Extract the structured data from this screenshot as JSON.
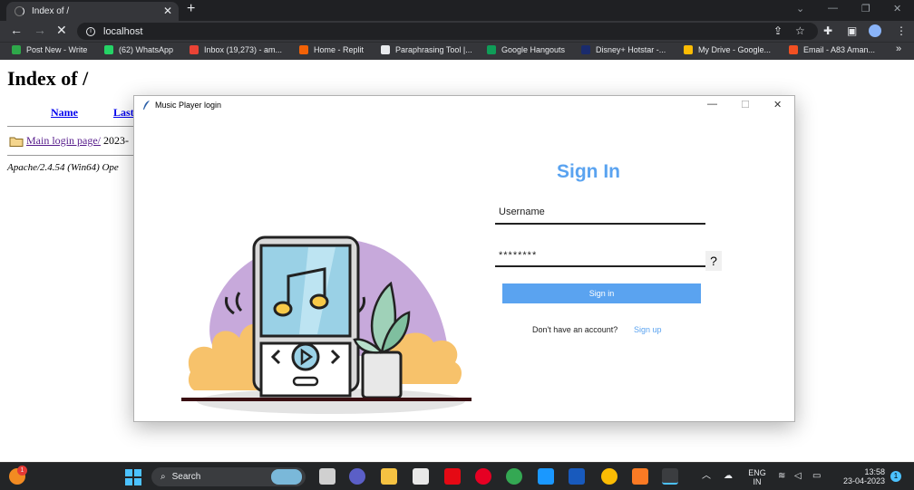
{
  "browser": {
    "tab_title": "Index of /",
    "url": "localhost",
    "bookmarks": [
      {
        "label": "Post New - Write",
        "color": "#2ea84a"
      },
      {
        "label": "(62) WhatsApp",
        "color": "#25d366"
      },
      {
        "label": "Inbox (19,273) - am...",
        "color": "#ea4335"
      },
      {
        "label": "Home - Replit",
        "color": "#f26207"
      },
      {
        "label": "Paraphrasing Tool |...",
        "color": "#e8eaed"
      },
      {
        "label": "Google Hangouts",
        "color": "#0f9d58"
      },
      {
        "label": "Disney+ Hotstar -...",
        "color": "#1a2b6d"
      },
      {
        "label": "My Drive - Google...",
        "color": "#fbbc04"
      },
      {
        "label": "Email - A83 Aman...",
        "color": "#f25022"
      }
    ],
    "more_bookmarks": "»"
  },
  "page": {
    "title": "Index of /",
    "col_name": "Name",
    "col_last": "Last",
    "row_link": "Main login page/",
    "row_date": "2023-",
    "server": "Apache/2.4.54 (Win64) Ope"
  },
  "dialog": {
    "window_title": "Music Player login",
    "heading": "Sign In",
    "username_value": "Username",
    "password_value": "********",
    "help_label": "?",
    "signin_button": "Sign in",
    "no_account_text": "Don't have an account?",
    "signup_link": "Sign up",
    "accent_color": "#5aa3f0"
  },
  "taskbar": {
    "search_label": "Search",
    "lang_top": "ENG",
    "lang_bottom": "IN",
    "time": "13:58",
    "date": "23-04-2023",
    "notif_count": "1",
    "weather_badge": "1"
  }
}
